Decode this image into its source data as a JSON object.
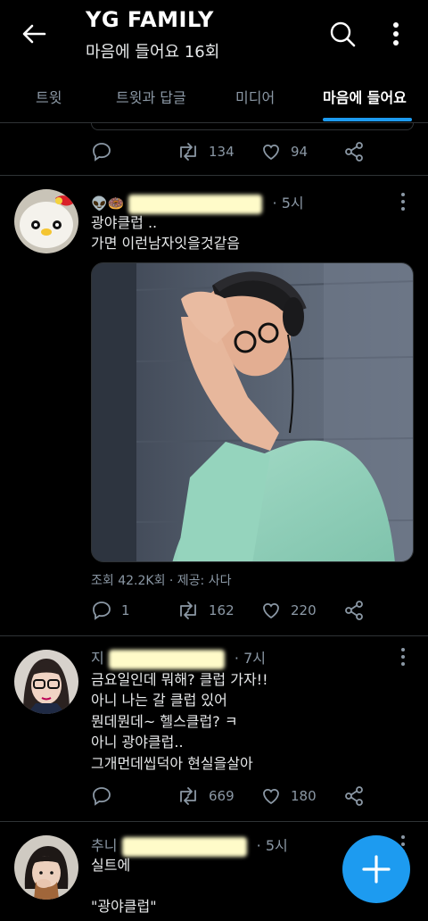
{
  "header": {
    "title": "YG FAMILY",
    "subtitle": "마음에 들어요 16회"
  },
  "tabs": [
    {
      "label": "트윗"
    },
    {
      "label": "트윗과 답글"
    },
    {
      "label": "미디어"
    },
    {
      "label": "마음에 들어요"
    }
  ],
  "prev_tweet": {
    "retweets": "134",
    "likes": "94"
  },
  "tweets": [
    {
      "name_emoji": "👽🍩",
      "time": "· 5시",
      "lines": [
        "광야클럽 ..",
        "가면 이런남자잇을것같음"
      ],
      "views": "조회 42.2K회 · 제공: 사다",
      "replies": "1",
      "retweets": "162",
      "likes": "220"
    },
    {
      "name_prefix": "지",
      "time": "· 7시",
      "lines": [
        "금요일인데 뭐해? 클럽 가자!!",
        "아니 나는 갈 클럽 있어",
        "뭔데뭔데~ 헬스클럽? ㅋ",
        "아니 광야클럽..",
        "그개먼데씹덕아 현실을살아"
      ],
      "retweets": "669",
      "likes": "180"
    },
    {
      "name_prefix": "추니",
      "time": "· 5시",
      "lines": [
        "실트에",
        "",
        "\"광야클럽\""
      ]
    }
  ],
  "colors": {
    "background": "#000000",
    "accent": "#1d9bf0",
    "muted": "#8b98a5",
    "divider": "#2f3336"
  }
}
